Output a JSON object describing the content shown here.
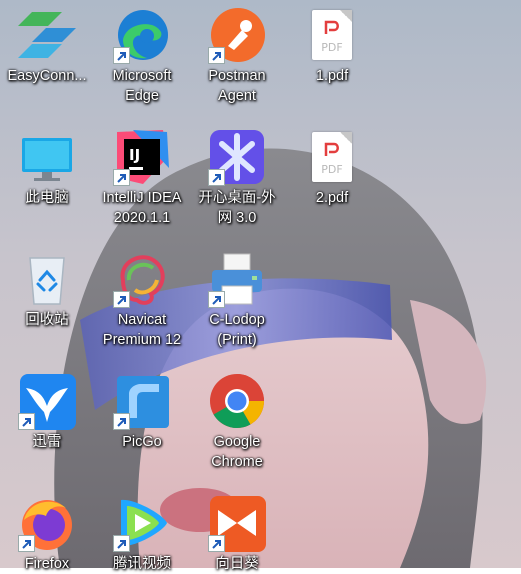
{
  "desktop": {
    "icons": [
      {
        "label": "EasyConn...",
        "icon": "easyconnect-icon"
      },
      {
        "label": "Microsoft Edge",
        "icon": "edge-icon"
      },
      {
        "label": "Postman Agent",
        "icon": "postman-icon"
      },
      {
        "label": "1.pdf",
        "icon": "pdf-file-icon"
      },
      {
        "label": "此电脑",
        "icon": "this-pc-icon"
      },
      {
        "label": "IntelliJ IDEA 2020.1.1",
        "icon": "intellij-idea-icon"
      },
      {
        "label": "开心桌面-外网 3.0",
        "icon": "happy-desktop-icon"
      },
      {
        "label": "2.pdf",
        "icon": "pdf-file-icon"
      },
      {
        "label": "回收站",
        "icon": "recycle-bin-icon"
      },
      {
        "label": "Navicat Premium 12",
        "icon": "navicat-icon"
      },
      {
        "label": "C-Lodop (Print)",
        "icon": "printer-icon"
      },
      {
        "label": "迅雷",
        "icon": "thunder-icon"
      },
      {
        "label": "PicGo",
        "icon": "picgo-icon"
      },
      {
        "label": "Google Chrome",
        "icon": "chrome-icon"
      },
      {
        "label": "Firefox",
        "icon": "firefox-icon"
      },
      {
        "label": "腾讯视频",
        "icon": "tencent-video-icon"
      },
      {
        "label": "向日葵",
        "icon": "sunlogin-icon"
      }
    ],
    "pdf_badge": "PDF"
  },
  "colors": {
    "label_text": "#ffffff",
    "shortcut_arrow": "#1e5bb8"
  }
}
